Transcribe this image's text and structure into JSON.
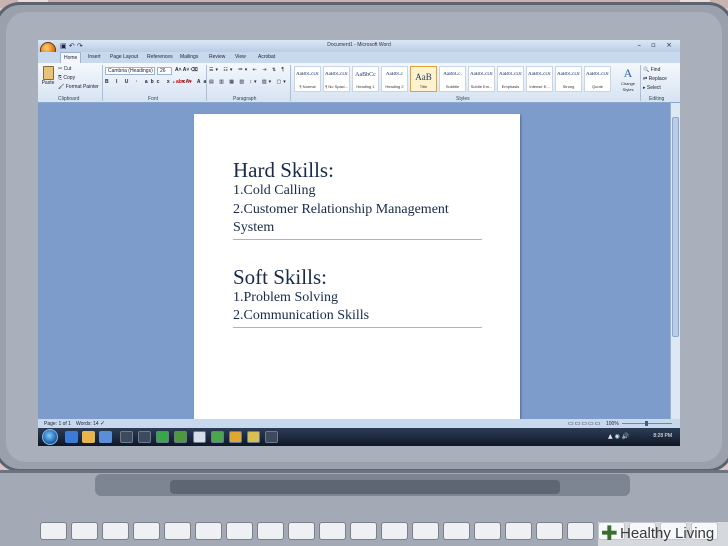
{
  "window": {
    "title": "Document1 - Microsoft Word",
    "controls": "– ▫ ×"
  },
  "quick_access": "▣ ↶ ↷",
  "tabs": [
    "Home",
    "Insert",
    "Page Layout",
    "References",
    "Mailings",
    "Review",
    "View",
    "Acrobat"
  ],
  "clipboard": {
    "paste": "Paste",
    "cut": "Cut",
    "copy": "Copy",
    "format_painter": "Format Painter",
    "group_label": "Clipboard"
  },
  "font": {
    "name": "Cambria (Headings)",
    "size": "26",
    "group_label": "Font"
  },
  "paragraph": {
    "group_label": "Paragraph"
  },
  "styles": {
    "group_label": "Styles",
    "items": [
      {
        "preview": "AaBbCcDc",
        "name": "¶ Normal"
      },
      {
        "preview": "AaBbCcDc",
        "name": "¶ No Spaci..."
      },
      {
        "preview": "AaBbCc",
        "name": "Heading 1"
      },
      {
        "preview": "AaBbCc",
        "name": "Heading 2"
      },
      {
        "preview": "AaB",
        "name": "Title"
      },
      {
        "preview": "AaBbCc.",
        "name": "Subtitle"
      },
      {
        "preview": "AaBbCcDc",
        "name": "Subtle Em..."
      },
      {
        "preview": "AaBbCcDc",
        "name": "Emphasis"
      },
      {
        "preview": "AaBbCcDc",
        "name": "Intense E..."
      },
      {
        "preview": "AaBbCcDc",
        "name": "Strong"
      },
      {
        "preview": "AaBbCcDc",
        "name": "Quote"
      }
    ],
    "change_styles": "Change Styles"
  },
  "editing": {
    "find": "Find",
    "replace": "Replace",
    "select": "Select",
    "group_label": "Editing"
  },
  "document": {
    "heading1": "Hard Skills:",
    "hard_items": [
      "1.Cold Calling",
      "2.Customer Relationship Management",
      "System"
    ],
    "heading2": "Soft Skills:",
    "soft_items": [
      "1.Problem Solving",
      "2.Communication Skills"
    ]
  },
  "status": {
    "page": "Page: 1 of 1",
    "words": "Words: 14",
    "zoom": "100%"
  },
  "taskbar": {
    "clock": "8:28 PM"
  },
  "watermark": {
    "text": "Healthy Living"
  },
  "colors": {
    "screen": "#3a5a87",
    "ribbon": "#d6e3f3",
    "doc_text": "#172a4a",
    "taskbar": "#0f1726"
  }
}
